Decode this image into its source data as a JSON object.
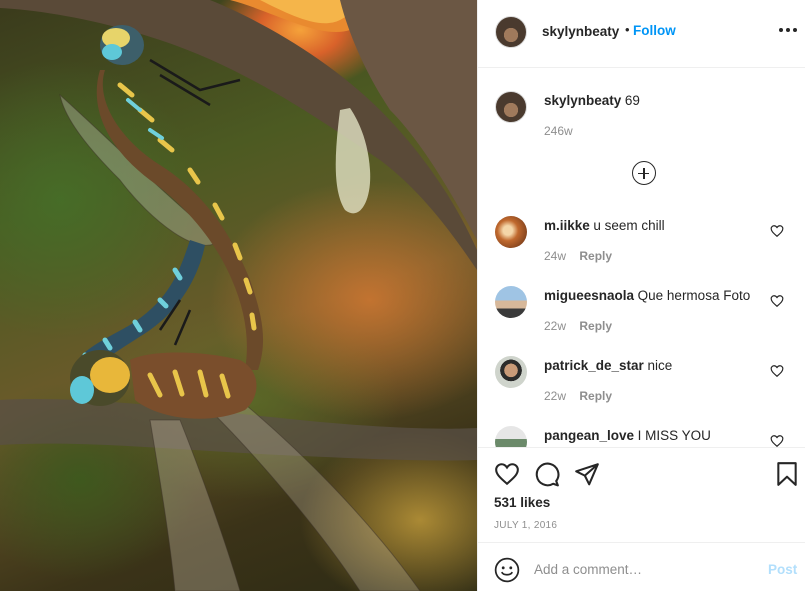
{
  "post": {
    "image_description": "",
    "owner": {
      "username": "skylynbeaty",
      "follow_label": "Follow",
      "separator": "•"
    },
    "more_icon": "more-horizontal-icon",
    "caption": {
      "username": "skylynbeaty",
      "text": "69",
      "time": "246w"
    },
    "load_more_icon": "plus-circle-icon",
    "comments": [
      {
        "username": "m.iikke",
        "text": "u seem chill",
        "time": "24w",
        "reply": "Reply"
      },
      {
        "username": "migueesnaola",
        "text": "Que hermosa Foto",
        "time": "22w",
        "reply": "Reply"
      },
      {
        "username": "patrick_de_star",
        "text": "nice",
        "time": "22w",
        "reply": "Reply"
      },
      {
        "username": "pangean_love",
        "text": "I MISS YOU",
        "time": "",
        "reply": ""
      }
    ],
    "actions": {
      "like_icon": "heart-icon",
      "comment_icon": "comment-icon",
      "share_icon": "paper-plane-icon",
      "save_icon": "bookmark-icon"
    },
    "likes": "531 likes",
    "date": "JULY 1, 2016",
    "add_comment": {
      "placeholder": "Add a comment…",
      "post_label": "Post",
      "emoji_icon": "smiley-icon"
    },
    "colors": {
      "link_blue": "#0095f6",
      "post_disabled": "#b2dffc",
      "secondary_text": "#8e8e8e",
      "primary_text": "#262626",
      "border": "#efefef"
    }
  }
}
